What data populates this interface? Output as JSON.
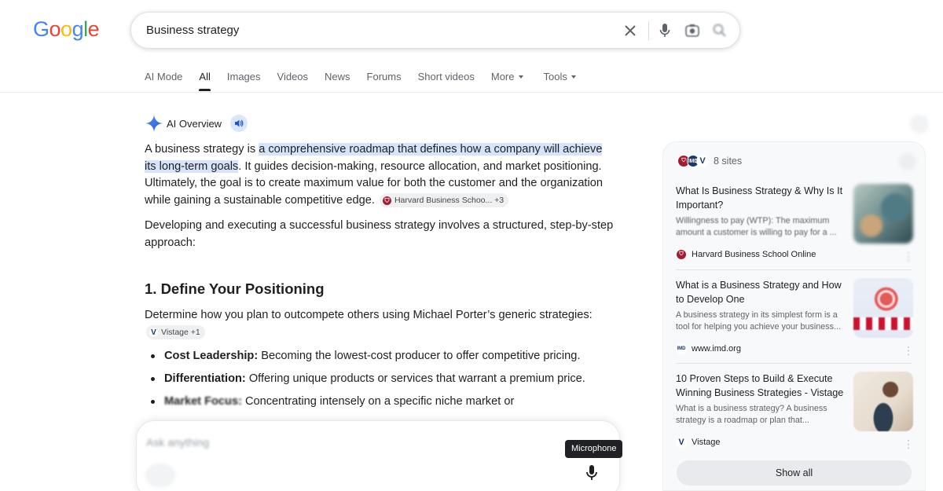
{
  "logo": "Google",
  "colors": {
    "blue": "#4285F4",
    "red": "#EA4335",
    "yellow": "#FBBC05",
    "green": "#34A853",
    "highlight": "#d6e4fb"
  },
  "search": {
    "query": "Business strategy"
  },
  "tabs": [
    {
      "label": "AI Mode"
    },
    {
      "label": "All",
      "active": true
    },
    {
      "label": "Images"
    },
    {
      "label": "Videos"
    },
    {
      "label": "News"
    },
    {
      "label": "Forums"
    },
    {
      "label": "Short videos"
    },
    {
      "label": "More"
    },
    {
      "label": "Tools"
    }
  ],
  "ai_overview": {
    "label": "AI Overview",
    "p1_start": "A business strategy is ",
    "p1_highlight": "a comprehensive roadmap that defines how a company will achieve its long-term goals",
    "p1_end": ". It guides decision-making, resource allocation, and market positioning. Ultimately, the goal is to create maximum value for both the customer and the organization while gaining a sustainable competitive edge.",
    "p1_chip": "Harvard Business Schoo... +3",
    "p2": "Developing and executing a successful business strategy involves a structured, step-by-step approach:",
    "h1": "1. Define Your Positioning",
    "p3": "Determine how you plan to outcompete others using Michael Porter’s generic strategies:",
    "p3_chip": "Vistage +1",
    "bullets": [
      {
        "bold": "Cost Leadership:",
        "text": " Becoming the lowest-cost producer to offer competitive pricing."
      },
      {
        "bold": "Differentiation:",
        "text": " Offering unique products or services that warrant a premium price."
      },
      {
        "bold": "Market Focus:",
        "text": " Concentrating intensely on a specific niche market or"
      }
    ]
  },
  "ask": {
    "placeholder": "Ask anything",
    "tooltip": "Microphone"
  },
  "sidebar": {
    "sites_count": "8 sites",
    "cards": [
      {
        "title": "What Is Business Strategy & Why Is It Important?",
        "desc": "Willingness to pay (WTP): The maximum amount a customer is willing to pay for a ...",
        "source": "Harvard Business School Online"
      },
      {
        "title": "What is a Business Strategy and How to Develop One",
        "desc": "A business strategy in its simplest form is a tool for helping you achieve your business...",
        "source": "www.imd.org"
      },
      {
        "title": "10 Proven Steps to Build & Execute Winning Business Strategies - Vistage",
        "desc": "What is a business strategy? A business strategy is a roadmap or plan that...",
        "source": "Vistage"
      }
    ],
    "show_all": "Show all"
  }
}
